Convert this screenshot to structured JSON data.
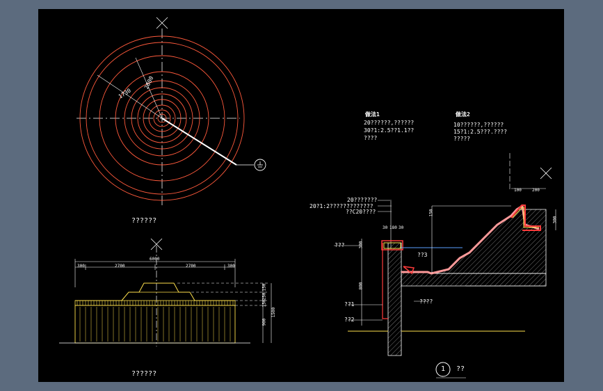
{
  "colors": {
    "background": "#000000",
    "frame": "#5c6b7e",
    "circle_line": "#ff5a3c",
    "center_line": "#ffffff",
    "yellow_line": "#ffe14d",
    "red_fill": "#ff3b3b",
    "pink_fill": "#ff9a9a",
    "hatch": "#aaaaaa"
  },
  "plan_view": {
    "title": "??????",
    "radius_labels": [
      "1730",
      "2000"
    ],
    "icon": "earth-ground-symbol"
  },
  "elevation_view": {
    "title": "??????",
    "top_dims": [
      "300",
      "2700",
      "2700",
      "300"
    ],
    "total_dim": "6000",
    "right_dims": [
      "150",
      "250",
      "150",
      "900",
      "1500"
    ]
  },
  "section_view": {
    "title_number": "1",
    "title_text": "??",
    "note1": {
      "heading": "做法1",
      "lines": [
        "20??????,??????",
        "30?1:2.5??1.1??",
        "????"
      ]
    },
    "note2": {
      "heading": "做法2",
      "lines": [
        "10??????,??????",
        "15?1:2.5???.????",
        "?????"
      ]
    },
    "left_labels": [
      "20???????",
      "20?1:2?????????????",
      "??C20????"
    ],
    "side_labels": [
      "???",
      "??1",
      "??2"
    ],
    "inner_labels": [
      "??3",
      "????"
    ],
    "top_dims": [
      "100",
      "200"
    ],
    "small_dims": [
      "30",
      "180",
      "30"
    ],
    "right_dims": [
      "300",
      "150"
    ],
    "vertical_dims": [
      "300",
      "800"
    ]
  }
}
